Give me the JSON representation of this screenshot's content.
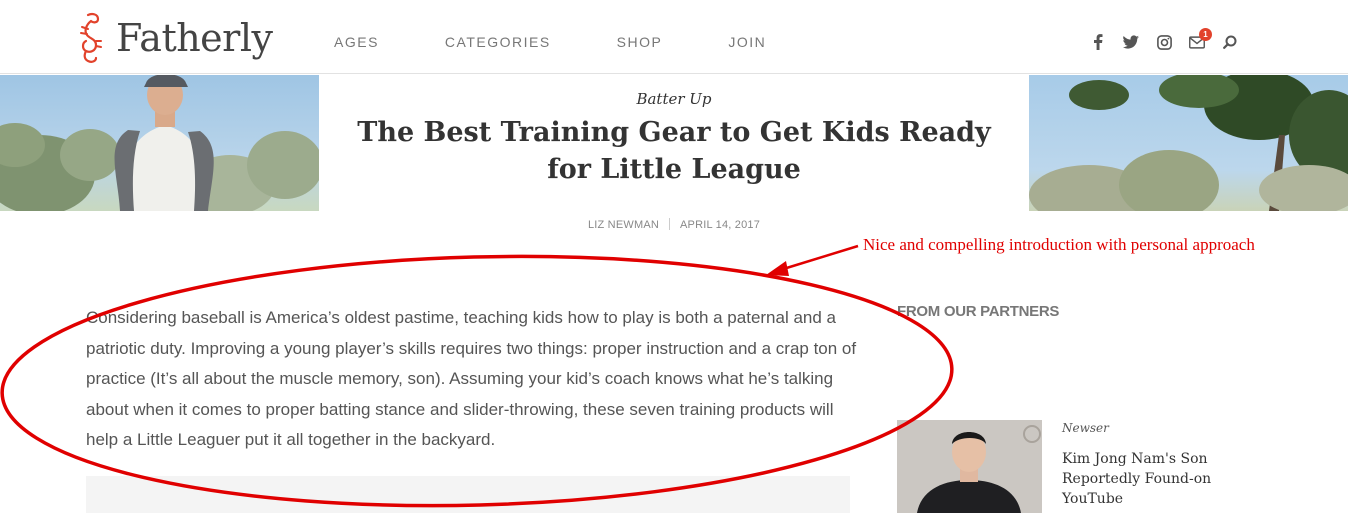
{
  "header": {
    "logo_text": "Fatherly",
    "nav": [
      "AGES",
      "CATEGORIES",
      "SHOP",
      "JOIN"
    ],
    "social_icons": [
      "facebook-icon",
      "twitter-icon",
      "instagram-icon",
      "mail-icon",
      "search-icon"
    ],
    "notification_count": "1"
  },
  "article": {
    "kicker": "Batter Up",
    "title": "The Best Training Gear to Get Kids Ready for Little League",
    "author": "LIZ NEWMAN",
    "date": "APRIL 14, 2017",
    "intro": "Considering baseball is America’s oldest pastime, teaching kids how to play is both a paternal and a patriotic duty. Improving a young player’s skills requires two things: proper instruction and a crap ton of practice (It’s all about the muscle memory, son). Assuming your kid’s coach knows what he’s talking about when it comes to proper batting stance and slider-throwing, these seven training products will help a Little Leaguer put it all together in the backyard."
  },
  "sidebar": {
    "heading": "FROM OUR PARTNERS",
    "card": {
      "source": "Newser",
      "title": "Kim Jong Nam's Son Reportedly Found-on YouTube"
    }
  },
  "annotation": {
    "text": "Nice and compelling introduction with personal approach",
    "color": "#e00000"
  },
  "colors": {
    "accent": "#e2422b",
    "text": "#333333",
    "muted": "#777777"
  }
}
